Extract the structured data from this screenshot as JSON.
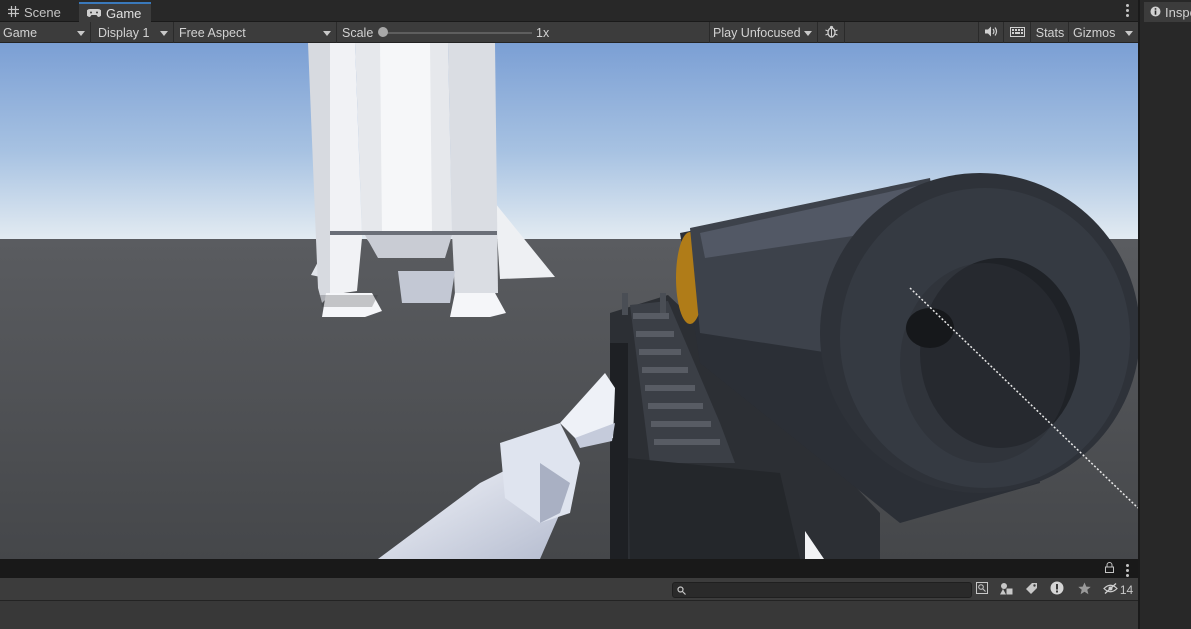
{
  "tabs": [
    {
      "label": "Scene",
      "icon": "grid-icon",
      "active": false
    },
    {
      "label": "Game",
      "icon": "gamepad-icon",
      "active": true
    }
  ],
  "toolbar": {
    "mode_label": "Game",
    "display_label": "Display 1",
    "aspect_label": "Free Aspect",
    "scale_label": "Scale",
    "scale_value": "1x",
    "scale_fraction": 0.0,
    "play_mode_label": "Play Unfocused",
    "stats_label": "Stats",
    "gizmos_label": "Gizmos"
  },
  "inspector": {
    "tab_label": "Inspe"
  },
  "console": {
    "search_placeholder": "",
    "hidden_count": "14"
  },
  "colors": {
    "sky_top": "#7a9ed3",
    "sky_horizon": "#d8e4ee",
    "ground": "#4b4d50",
    "accent_tab": "#3a79bb"
  }
}
